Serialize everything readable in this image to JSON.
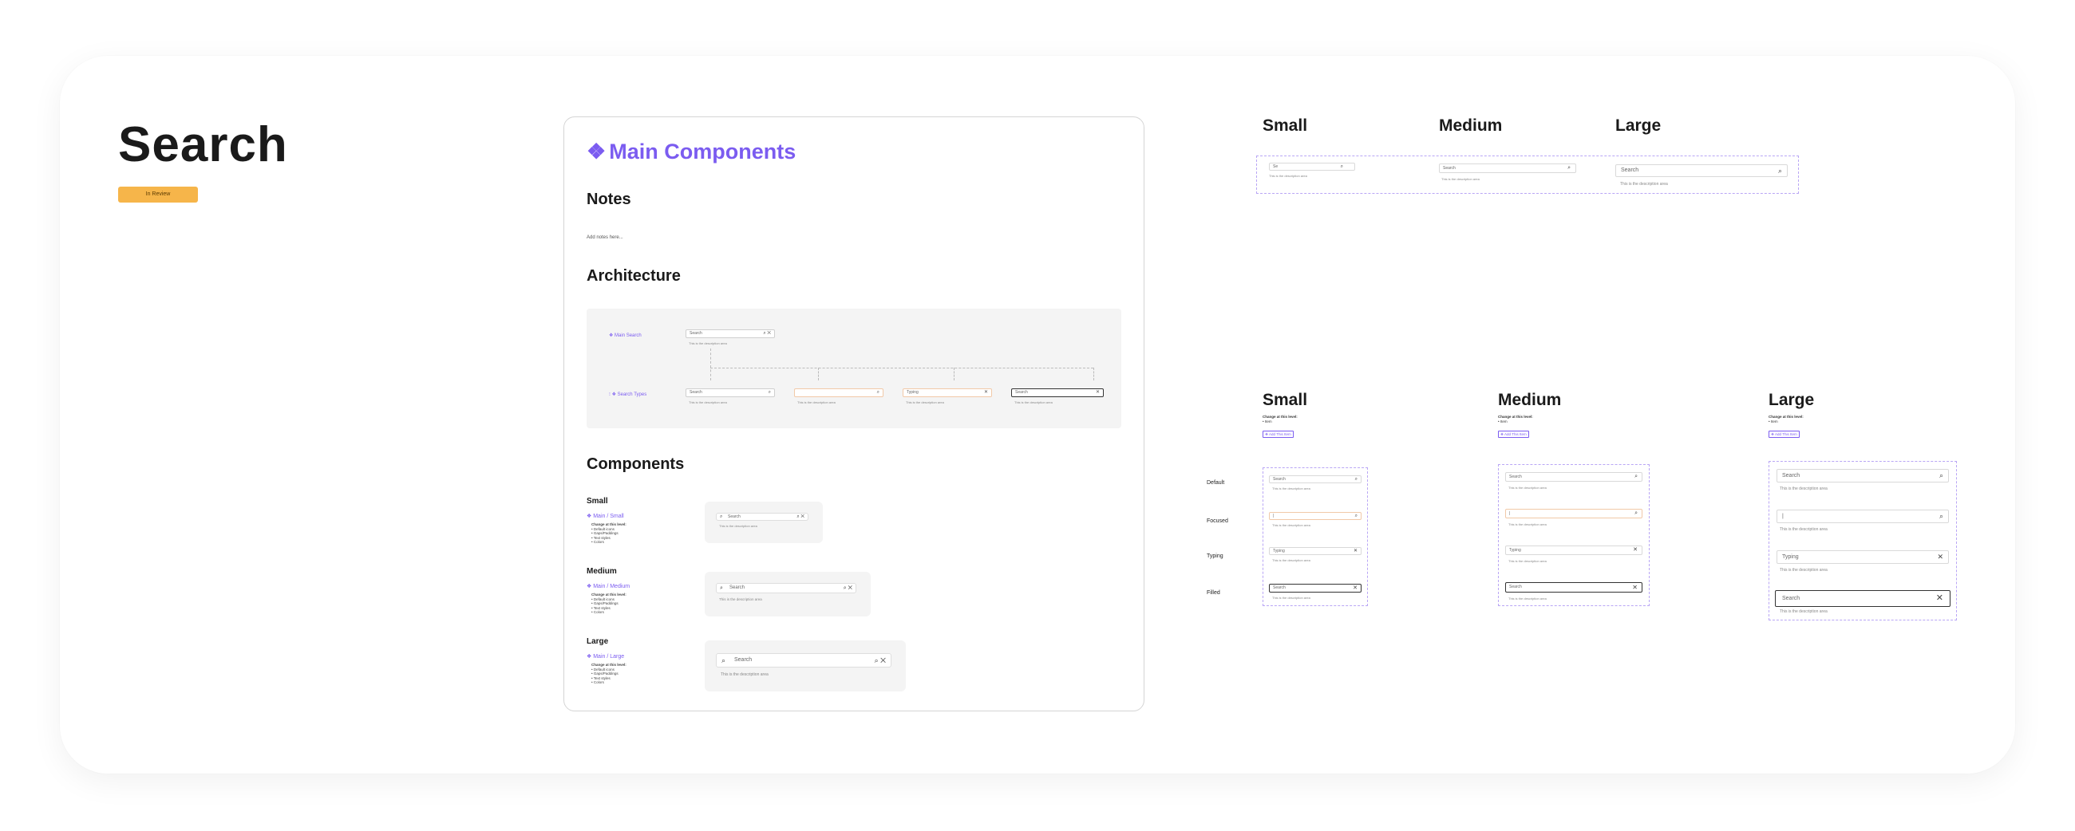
{
  "page": {
    "title": "Search",
    "badge": "In Review"
  },
  "main": {
    "title": "Main Components",
    "star": "❖",
    "notes_heading": "Notes",
    "notes_text": "Add notes here...",
    "architecture_heading": "Architecture",
    "arch": {
      "main_label": "❖ Main Search",
      "types_label": "⁝ ❖ Search Types",
      "search_text": "Search",
      "typing_text": "Typing",
      "desc": "This is the description area"
    },
    "components_heading": "Components",
    "components": [
      {
        "size": "Small",
        "link": "❖ Main / Small",
        "note_title": "Change at this level:",
        "notes": [
          "• Default icons",
          "• Gaps/Paddings",
          "• Text styles",
          "• Colors"
        ],
        "placeholder": "Search",
        "desc": "This is the description area"
      },
      {
        "size": "Medium",
        "link": "❖ Main / Medium",
        "note_title": "Change at this level:",
        "notes": [
          "• Default icons",
          "• Gaps/Paddings",
          "• Text styles",
          "• Colors"
        ],
        "placeholder": "Search",
        "desc": "This is the description area"
      },
      {
        "size": "Large",
        "link": "❖ Main / Large",
        "note_title": "Change at this level:",
        "notes": [
          "• Default icons",
          "• Gaps/Paddings",
          "• Text styles",
          "• Colors"
        ],
        "placeholder": "Search",
        "desc": "This is the description area"
      }
    ]
  },
  "top_sizes": {
    "small": "Small",
    "medium": "Medium",
    "large": "Large",
    "small_value": "Se",
    "search": "Search",
    "desc": "This is the description area"
  },
  "variants": {
    "small": "Small",
    "medium": "Medium",
    "large": "Large",
    "note_title": "Change at this level:",
    "note_item": "• Item",
    "add_tag": "❖ Add This Item",
    "states": [
      "Default",
      "Focused",
      "Typing",
      "Filled"
    ],
    "default_text": "Search",
    "focused_text": "|",
    "typing_text": "Typing",
    "filled_text": "Search",
    "desc": "This is the description area"
  },
  "icons": {
    "search": "search-icon",
    "close": "close-icon"
  },
  "colors": {
    "accent": "#7b5cf0",
    "badge": "#f6b54a",
    "dashed": "#b9a6f5"
  }
}
